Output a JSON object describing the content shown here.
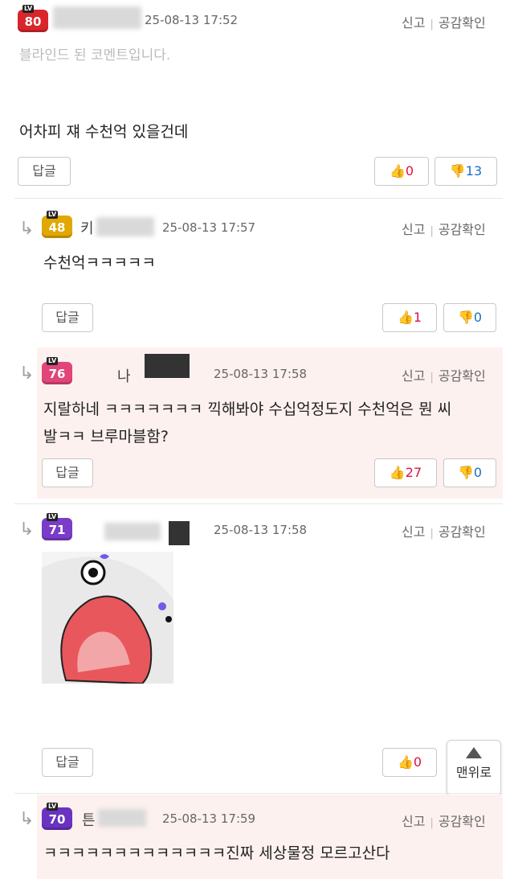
{
  "comments": [
    {
      "level": "80",
      "date": "25-08-13 17:52",
      "report": "신고",
      "empathy": "공감확인",
      "blinded": "블라인드 된 코멘트입니다.",
      "text": "어차피 쟤 수천억 있을건데",
      "reply": "답글",
      "likes": "0",
      "dislikes": "13",
      "badge_color": "#d9262d"
    },
    {
      "level": "48",
      "nick": "키",
      "date": "25-08-13 17:57",
      "report": "신고",
      "empathy": "공감확인",
      "text": "수천억ㅋㅋㅋㅋㅋ",
      "reply": "답글",
      "likes": "1",
      "dislikes": "0",
      "badge_color": "#e0a800"
    },
    {
      "level": "76",
      "nick": "나",
      "date": "25-08-13 17:58",
      "report": "신고",
      "empathy": "공감확인",
      "text_line1": "지랄하네 ㅋㅋㅋㅋㅋㅋㅋ 끽해봐야 수십억정도지 수천억은 뭔 씨",
      "text_line2": "발ㅋㅋ 브루마블함?",
      "reply": "답글",
      "likes": "27",
      "dislikes": "0",
      "badge_color": "#e2457a"
    },
    {
      "level": "71",
      "date": "25-08-13 17:58",
      "report": "신고",
      "empathy": "공감확인",
      "reply": "답글",
      "likes": "0",
      "badge_color": "#7a3cc9"
    },
    {
      "level": "70",
      "nick": "튼",
      "date": "25-08-13 17:59",
      "report": "신고",
      "empathy": "공감확인",
      "text": "ㅋㅋㅋㅋㅋㅋㅋㅋㅋㅋㅋㅋㅋ진짜 세상물정 모르고산다",
      "badge_color": "#6a32c0"
    }
  ],
  "scroll_top": {
    "label": "맨위로"
  },
  "icons": {
    "reply_arrow": "↳",
    "like": "like-thumb-icon",
    "dislike": "dislike-thumb-icon"
  }
}
